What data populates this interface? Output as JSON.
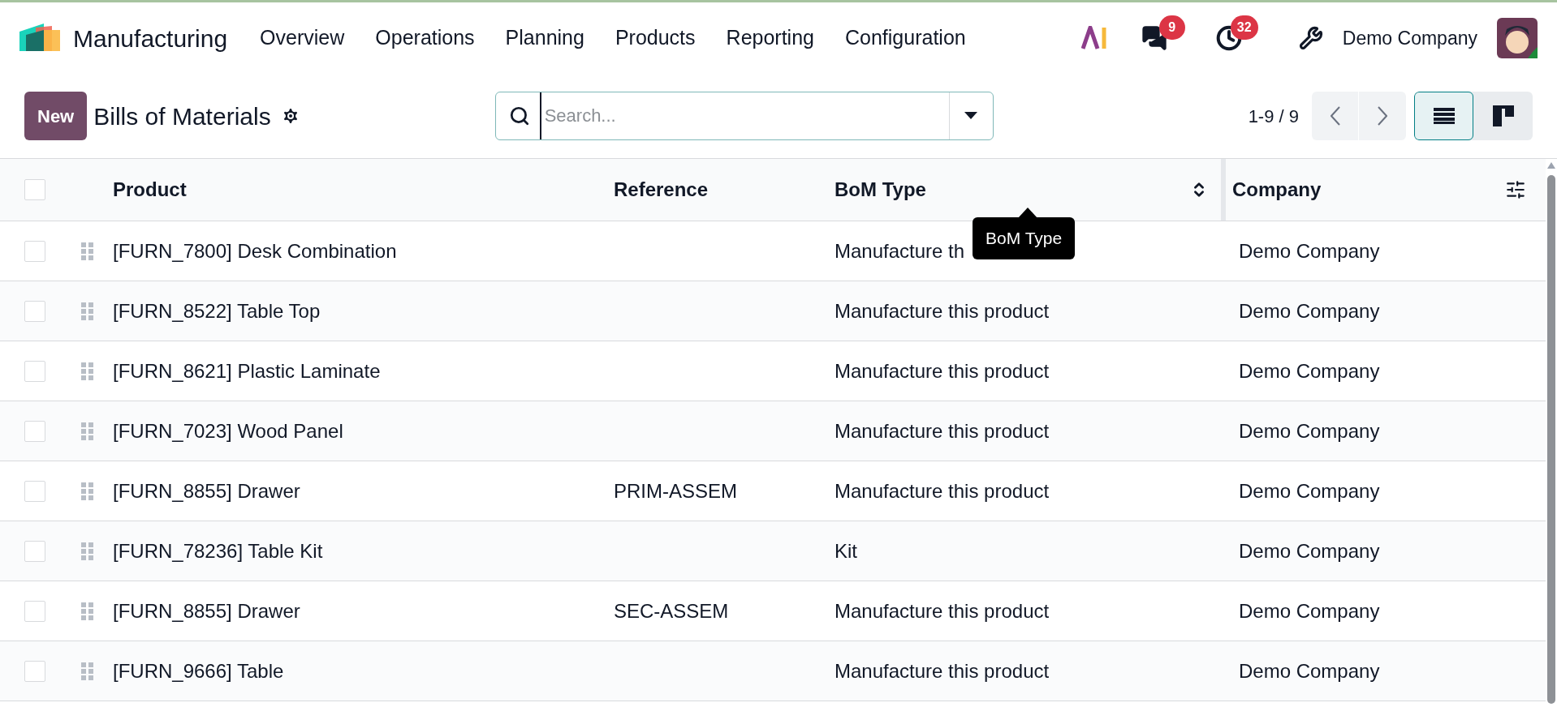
{
  "navbar": {
    "app_name": "Manufacturing",
    "menu": [
      "Overview",
      "Operations",
      "Planning",
      "Products",
      "Reporting",
      "Configuration"
    ],
    "messages_badge": "9",
    "activities_badge": "32",
    "company": "Demo Company"
  },
  "control_panel": {
    "new_button": "New",
    "title": "Bills of Materials",
    "search": {
      "placeholder": "Search..."
    },
    "pager": "1-9 / 9",
    "views": [
      {
        "kind": "list",
        "selected": true
      },
      {
        "kind": "kanban",
        "selected": false
      }
    ]
  },
  "table": {
    "select_all": {
      "checked": false
    },
    "columns": [
      "Product",
      "Reference",
      "BoM Type",
      "Company"
    ],
    "tooltip": "BoM Type",
    "rows": [
      {
        "checked": false,
        "product": "[FURN_7800] Desk Combination",
        "reference": "",
        "bom_type": "Manufacture th",
        "company": "Demo Company"
      },
      {
        "checked": false,
        "product": "[FURN_8522] Table Top",
        "reference": "",
        "bom_type": "Manufacture this product",
        "company": "Demo Company"
      },
      {
        "checked": false,
        "product": "[FURN_8621] Plastic Laminate",
        "reference": "",
        "bom_type": "Manufacture this product",
        "company": "Demo Company"
      },
      {
        "checked": false,
        "product": "[FURN_7023] Wood Panel",
        "reference": "",
        "bom_type": "Manufacture this product",
        "company": "Demo Company"
      },
      {
        "checked": false,
        "product": "[FURN_8855] Drawer",
        "reference": "PRIM-ASSEM",
        "bom_type": "Manufacture this product",
        "company": "Demo Company"
      },
      {
        "checked": false,
        "product": "[FURN_78236] Table Kit",
        "reference": "",
        "bom_type": "Kit",
        "company": "Demo Company"
      },
      {
        "checked": false,
        "product": "[FURN_8855] Drawer",
        "reference": "SEC-ASSEM",
        "bom_type": "Manufacture this product",
        "company": "Demo Company"
      },
      {
        "checked": false,
        "product": "[FURN_9666] Table",
        "reference": "",
        "bom_type": "Manufacture this product",
        "company": "Demo Company"
      }
    ]
  }
}
